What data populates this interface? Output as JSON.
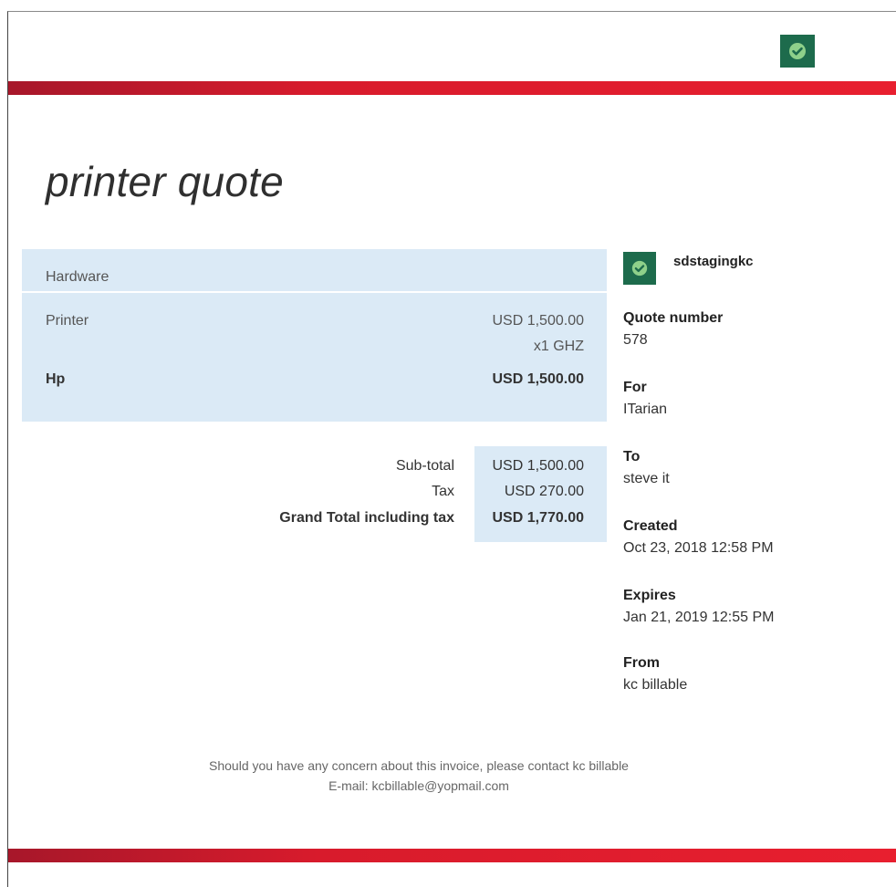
{
  "document": {
    "title": "printer quote"
  },
  "brand": {
    "logo_icon": "green-check-badge-icon",
    "accent_color": "#1d6b4c",
    "stripe_color": "#e31f2f"
  },
  "items": {
    "section_label": "Hardware",
    "item_name": "Printer",
    "item_price": "USD 1,500.00",
    "item_quantity": "x1 GHZ",
    "item_brand": "Hp",
    "item_total": "USD 1,500.00"
  },
  "totals": {
    "subtotal_label": "Sub-total",
    "subtotal_value": "USD 1,500.00",
    "tax_label": "Tax",
    "tax_value": "USD 270.00",
    "grand_label": "Grand Total including tax",
    "grand_value": "USD 1,770.00"
  },
  "company": {
    "name": "sdstagingkc"
  },
  "details": {
    "quote_number_label": "Quote number",
    "quote_number_value": "578",
    "for_label": "For",
    "for_value": "ITarian",
    "to_label": "To",
    "to_value": "steve it",
    "created_label": "Created",
    "created_value": "Oct 23, 2018 12:58 PM",
    "expires_label": "Expires",
    "expires_value": "Jan 21, 2019 12:55 PM",
    "from_label": "From",
    "from_value": "kc billable"
  },
  "footer": {
    "contact_line": "Should you have any concern about this invoice, please contact kc billable",
    "email_line": "E-mail: kcbillable@yopmail.com"
  }
}
